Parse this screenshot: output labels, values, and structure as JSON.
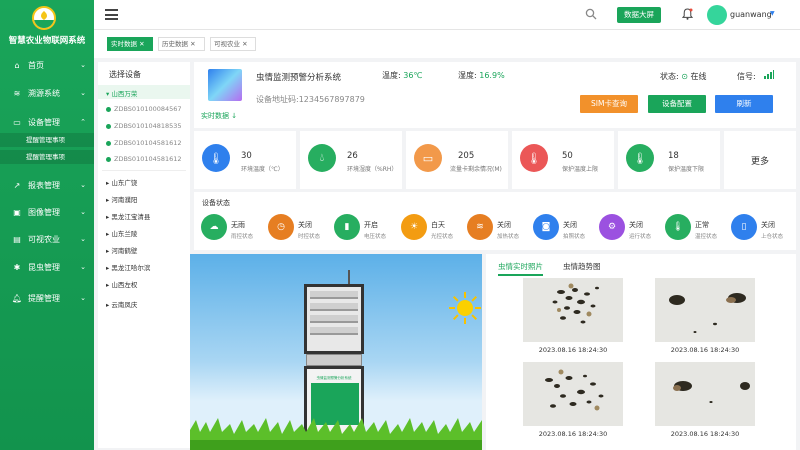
{
  "app": {
    "title": "智慧农业物联网系统",
    "brand_color": "#1aa55a"
  },
  "sidebar": {
    "items": [
      {
        "label": "首页",
        "icon": "home-icon"
      },
      {
        "label": "溯源系统",
        "icon": "trace-icon"
      },
      {
        "label": "设备管理",
        "icon": "device-icon"
      },
      {
        "label": "报表管理",
        "icon": "chart-icon"
      },
      {
        "label": "图像管理",
        "icon": "image-icon"
      },
      {
        "label": "可视农业",
        "icon": "visual-icon"
      },
      {
        "label": "昆虫管理",
        "icon": "bug-icon"
      },
      {
        "label": "提醒管理",
        "icon": "bell-icon"
      }
    ],
    "subitems": [
      "提醒管理事项",
      "提醒管理事项"
    ]
  },
  "header": {
    "big_screen": "数据大屏",
    "username": "guanwang",
    "menu_icon": "hamburger-icon",
    "search_icon": "search-icon",
    "bell_icon": "bell-icon"
  },
  "tabs": [
    {
      "label": "实时数据",
      "active": true
    },
    {
      "label": "历史数据",
      "active": false
    },
    {
      "label": "可视农业",
      "active": false
    }
  ],
  "devices": {
    "title": "选择设备",
    "groups": [
      {
        "label": "山西万荣",
        "expanded": true,
        "children": [
          "ZDBS010100084567",
          "ZDBS010104818535",
          "ZDBS010104581612",
          "ZDBS010104581612"
        ]
      },
      {
        "label": "山东广饶"
      },
      {
        "label": "河南濮阳"
      },
      {
        "label": "黑龙江宝清县"
      },
      {
        "label": "山东兰陵"
      },
      {
        "label": "河南鹤壁"
      },
      {
        "label": "黑龙江哈尔滨"
      },
      {
        "label": "山西左权"
      },
      {
        "label": "云南凤庆"
      }
    ]
  },
  "info": {
    "system_name": "虫情监测预警分析系统",
    "address_label": "设备地址码:",
    "address": "1234567897879",
    "temp_label": "温度:",
    "temp_value": "36℃",
    "humidity_label": "湿度:",
    "humidity_value": "16.9%",
    "status_label": "状态:",
    "status_value": "在线",
    "signal_label": "信号:",
    "realtime_label": "实时数据",
    "buttons": {
      "sim": "SIM卡查询",
      "config": "设备配置",
      "refresh": "刷新"
    }
  },
  "stats": [
    {
      "value": "30",
      "label": "环境温度（℃）",
      "color": "#2f80ed",
      "icon": "thermometer-icon"
    },
    {
      "value": "26",
      "label": "环境湿度（%RH）",
      "color": "#27ae60",
      "icon": "droplet-icon"
    },
    {
      "value": "205",
      "label": "流量卡剩余情况(M)",
      "color": "#f2994a",
      "icon": "sim-card-icon"
    },
    {
      "value": "50",
      "label": "保护温度上限",
      "color": "#eb5757",
      "icon": "temp-up-icon"
    },
    {
      "value": "18",
      "label": "保护温度下限",
      "color": "#27ae60",
      "icon": "temp-down-icon"
    }
  ],
  "more_label": "更多",
  "device_status": {
    "title": "设备状态",
    "items": [
      {
        "value": "无雨",
        "label": "雨控状态",
        "color": "#27ae60",
        "icon": "cloud-icon"
      },
      {
        "value": "关闭",
        "label": "时控状态",
        "color": "#e67e22",
        "icon": "clock-icon"
      },
      {
        "value": "开启",
        "label": "电压状态",
        "color": "#27ae60",
        "icon": "battery-icon"
      },
      {
        "value": "白天",
        "label": "光控状态",
        "color": "#f39c12",
        "icon": "sun-icon"
      },
      {
        "value": "关闭",
        "label": "加热状态",
        "color": "#e67e22",
        "icon": "heater-icon"
      },
      {
        "value": "关闭",
        "label": "拍照状态",
        "color": "#2f80ed",
        "icon": "camera-icon"
      },
      {
        "value": "关闭",
        "label": "运行状态",
        "color": "#9b51e0",
        "icon": "run-icon"
      },
      {
        "value": "正常",
        "label": "温控状态",
        "color": "#27ae60",
        "icon": "temp-control-icon"
      },
      {
        "value": "关闭",
        "label": "上仓状态",
        "color": "#2f80ed",
        "icon": "door-icon"
      }
    ]
  },
  "device_image": {
    "caption": "虫情监测预警分析系统"
  },
  "photos": {
    "tabs": [
      "虫情实时照片",
      "虫情趋势图"
    ],
    "items": [
      {
        "time": "2023.08.16 18:24:30"
      },
      {
        "time": "2023.08.16 18:24:30"
      },
      {
        "time": "2023.08.16 18:24:30"
      },
      {
        "time": "2023.08.16 18:24:30"
      }
    ]
  }
}
